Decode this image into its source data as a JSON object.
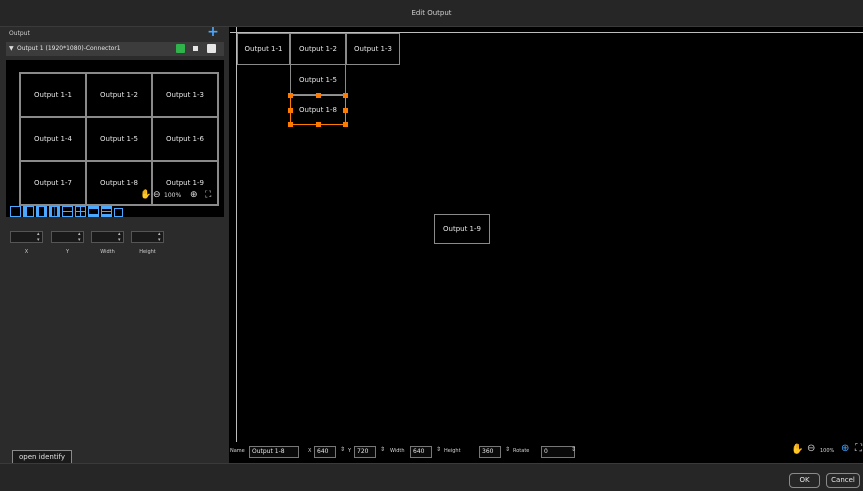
{
  "window": {
    "title": "Edit Output"
  },
  "left_panel": {
    "header": "Output",
    "output_row_label": "Output 1 (1920*1080)-Connector1",
    "grid_cells": [
      "Output 1-1",
      "Output 1-2",
      "Output 1-3",
      "Output 1-4",
      "Output 1-5",
      "Output 1-6",
      "Output 1-7",
      "Output 1-8",
      "Output 1-9"
    ],
    "zoom": "100%",
    "field_labels": {
      "x": "X",
      "y": "Y",
      "width": "Width",
      "height": "Height"
    },
    "identify_button": "open identify"
  },
  "canvas": {
    "outputs": [
      "Output 1-1",
      "Output 1-2",
      "Output 1-3",
      "Output 1-5",
      "Output 1-8",
      "Output 1-9"
    ]
  },
  "props": {
    "name_label": "Name",
    "name_value": "Output 1-8",
    "x_label": "X",
    "x_value": "640",
    "y_label": "Y",
    "y_value": "720",
    "width_label": "Width",
    "width_value": "640",
    "height_label": "Height",
    "height_value": "360",
    "rotate_label": "Rotate",
    "rotate_value": "0",
    "zoom": "100%"
  },
  "footer": {
    "ok": "OK",
    "cancel": "Cancel"
  },
  "colors": {
    "accent": "#4aa8ff",
    "selection": "#ff7a00",
    "green_icon": "#2fb34a"
  }
}
